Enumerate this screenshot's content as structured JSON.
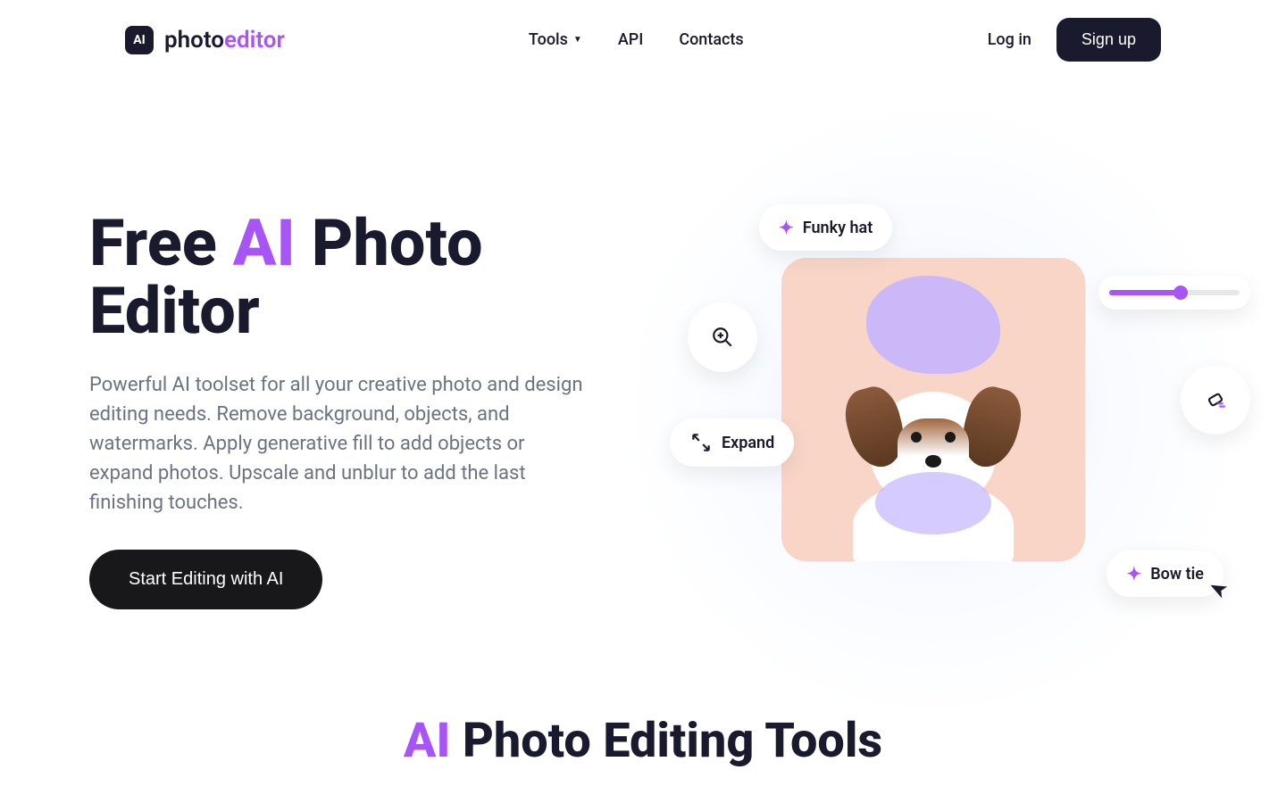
{
  "logo": {
    "badge": "AI",
    "text_a": "photo",
    "text_b": "editor"
  },
  "nav": {
    "tools": "Tools",
    "api": "API",
    "contacts": "Contacts"
  },
  "auth": {
    "login": "Log in",
    "signup": "Sign up"
  },
  "hero": {
    "title_pre": "Free ",
    "title_accent": "AI",
    "title_post": " Photo Editor",
    "subtitle": "Powerful AI toolset for all your creative photo and design editing needs. Remove background, objects, and watermarks. Apply generative fill to add objects or expand photos. Upscale and unblur to add the last finishing touches.",
    "cta": "Start Editing with AI"
  },
  "overlays": {
    "funky_hat": "Funky hat",
    "expand": "Expand",
    "bow_tie": "Bow tie"
  },
  "section2": {
    "title_accent": "AI",
    "title_post": " Photo Editing Tools"
  },
  "colors": {
    "accent": "#a855f7",
    "dark": "#1a1a2e"
  }
}
